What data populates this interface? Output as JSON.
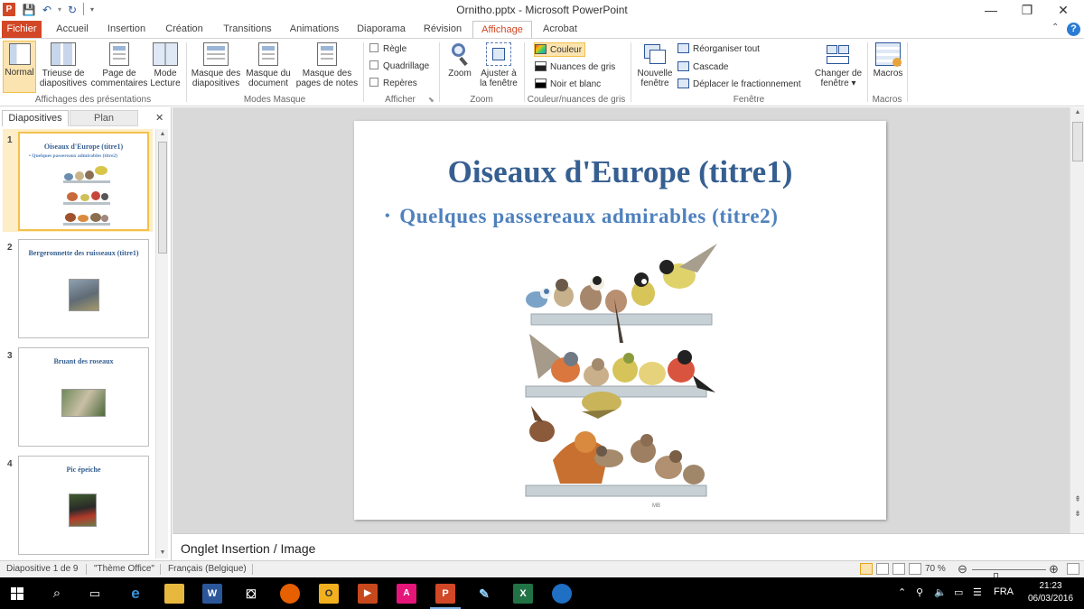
{
  "window": {
    "title": "Ornitho.pptx - Microsoft PowerPoint",
    "app_letter": "P",
    "controls": {
      "minimize": "—",
      "restore": "❐",
      "close": "✕"
    }
  },
  "tabs": [
    {
      "label": "Fichier"
    },
    {
      "label": "Accueil"
    },
    {
      "label": "Insertion"
    },
    {
      "label": "Création"
    },
    {
      "label": "Transitions"
    },
    {
      "label": "Animations"
    },
    {
      "label": "Diaporama"
    },
    {
      "label": "Révision"
    },
    {
      "label": "Affichage"
    },
    {
      "label": "Acrobat"
    }
  ],
  "ribbon": {
    "groups": {
      "presentation_views": "Affichages des présentations",
      "master_views": "Modes Masque",
      "show": "Afficher",
      "zoom": "Zoom",
      "color": "Couleur/nuances de gris",
      "window": "Fenêtre",
      "macros": "Macros"
    },
    "buttons": {
      "normal": "Normal",
      "sorter_1": "Trieuse de",
      "sorter_2": "diapositives",
      "notes_1": "Page de",
      "notes_2": "commentaires",
      "reading_1": "Mode",
      "reading_2": "Lecture",
      "slide_master_1": "Masque des",
      "slide_master_2": "diapositives",
      "handout_master_1": "Masque du",
      "handout_master_2": "document",
      "notes_master_1": "Masque des",
      "notes_master_2": "pages de notes",
      "ruler": "Règle",
      "gridlines": "Quadrillage",
      "guides": "Repères",
      "zoom": "Zoom",
      "fit_1": "Ajuster à",
      "fit_2": "la fenêtre",
      "color": "Couleur",
      "grayscale": "Nuances de gris",
      "bw": "Noir et blanc",
      "new_window_1": "Nouvelle",
      "new_window_2": "fenêtre",
      "arrange_all": "Réorganiser tout",
      "cascade": "Cascade",
      "move_split": "Déplacer le fractionnement",
      "switch_window_1": "Changer de",
      "switch_window_2": "fenêtre ▾",
      "macros": "Macros"
    }
  },
  "panel": {
    "tabs": {
      "slides": "Diapositives",
      "outline": "Plan",
      "close": "✕"
    },
    "thumbnails": [
      {
        "num": "1",
        "title": "Oiseaux d'Europe (titre1)",
        "subtitle": "•  Quelques passereaux admirables (titre2)"
      },
      {
        "num": "2",
        "title": "Bergeronnette des ruisseaux (titre1)"
      },
      {
        "num": "3",
        "title": "Bruant des roseaux"
      },
      {
        "num": "4",
        "title": "Pic épeiche"
      }
    ]
  },
  "slide": {
    "title": "Oiseaux d'Europe (titre1)",
    "bullet": "Quelques passereaux admirables (titre2)",
    "signature": "MB"
  },
  "notes": {
    "text": "Onglet Insertion / Image"
  },
  "status": {
    "slide_info": "Diapositive 1 de 9",
    "theme": "\"Thème Office\"",
    "language": "Français (Belgique)",
    "zoom": "70 %",
    "zoom_level_percent": 70
  },
  "taskbar": {
    "language": "FRA",
    "time": "21:23",
    "date": "06/03/2016"
  },
  "colors": {
    "accent": "#d24726",
    "title_blue": "#365f91",
    "body_blue": "#4f81bd",
    "selection": "#fce4b0"
  },
  "icons": [
    "windows-start-icon",
    "search-icon",
    "task-view-icon",
    "edge-icon",
    "file-explorer-icon",
    "word-icon",
    "store-icon",
    "firefox-icon",
    "outlook-icon",
    "media-icon",
    "acrobat-icon",
    "powerpoint-icon",
    "paint-icon",
    "excel-icon",
    "thunderbird-icon"
  ]
}
